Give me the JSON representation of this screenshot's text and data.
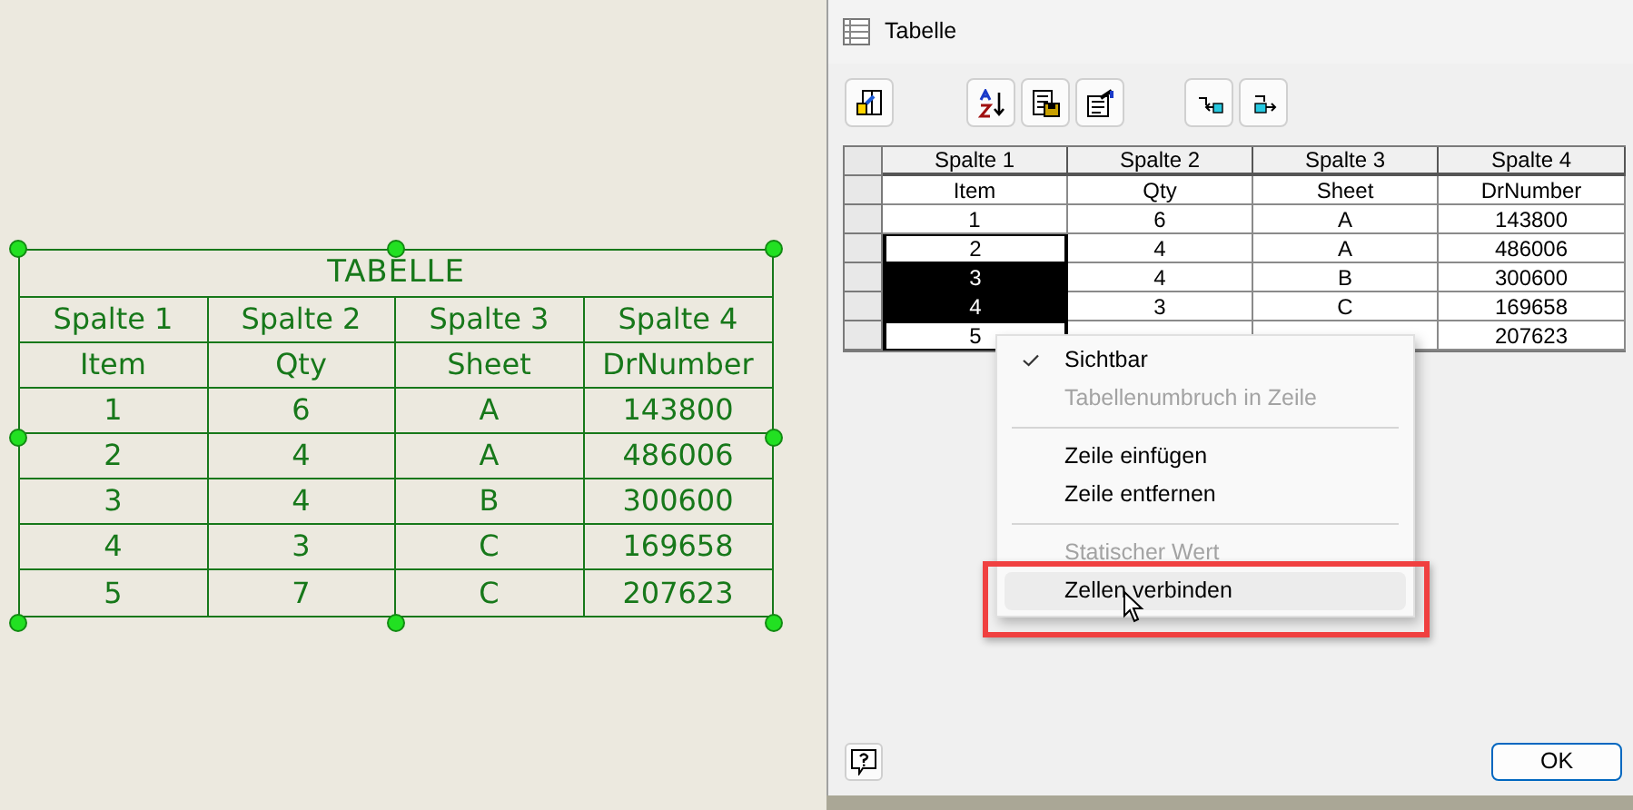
{
  "drawing": {
    "title": "TABELLE",
    "rows": [
      [
        "Spalte 1",
        "Spalte 2",
        "Spalte 3",
        "Spalte 4"
      ],
      [
        "Item",
        "Qty",
        "Sheet",
        "DrNumber"
      ],
      [
        "1",
        "6",
        "A",
        "143800"
      ],
      [
        "2",
        "4",
        "A",
        "486006"
      ],
      [
        "3",
        "4",
        "B",
        "300600"
      ],
      [
        "4",
        "3",
        "C",
        "169658"
      ],
      [
        "5",
        "7",
        "C",
        "207623"
      ]
    ]
  },
  "dialog": {
    "title": "Tabelle",
    "grid": {
      "columns": [
        "Spalte 1",
        "Spalte 2",
        "Spalte 3",
        "Spalte 4"
      ],
      "rows": [
        {
          "cells": [
            {
              "text": "Item",
              "selected": false,
              "in_range": false
            },
            {
              "text": "Qty",
              "selected": false,
              "in_range": false
            },
            {
              "text": "Sheet",
              "selected": false,
              "in_range": false
            },
            {
              "text": "DrNumber",
              "selected": false,
              "in_range": false
            }
          ]
        },
        {
          "cells": [
            {
              "text": "1",
              "selected": false,
              "in_range": false
            },
            {
              "text": "6",
              "selected": false,
              "in_range": false
            },
            {
              "text": "A",
              "selected": false,
              "in_range": false
            },
            {
              "text": "143800",
              "selected": false,
              "in_range": false
            }
          ]
        },
        {
          "cells": [
            {
              "text": "2",
              "selected": false,
              "in_range": true
            },
            {
              "text": "4",
              "selected": false,
              "in_range": false
            },
            {
              "text": "A",
              "selected": false,
              "in_range": false
            },
            {
              "text": "486006",
              "selected": false,
              "in_range": false
            }
          ]
        },
        {
          "cells": [
            {
              "text": "3",
              "selected": true,
              "in_range": true
            },
            {
              "text": "4",
              "selected": false,
              "in_range": false
            },
            {
              "text": "B",
              "selected": false,
              "in_range": false
            },
            {
              "text": "300600",
              "selected": false,
              "in_range": false
            }
          ]
        },
        {
          "cells": [
            {
              "text": "4",
              "selected": true,
              "in_range": true
            },
            {
              "text": "3",
              "selected": false,
              "in_range": false
            },
            {
              "text": "C",
              "selected": false,
              "in_range": false
            },
            {
              "text": "169658",
              "selected": false,
              "in_range": false
            }
          ]
        },
        {
          "cells": [
            {
              "text": "5",
              "selected": false,
              "in_range": true
            },
            {
              "selected": false,
              "in_range": false
            },
            {
              "selected": false,
              "in_range": false
            },
            {
              "text": "207623",
              "selected": false,
              "in_range": false
            }
          ]
        }
      ]
    },
    "context_menu": {
      "items": [
        {
          "kind": "item",
          "label": "Sichtbar",
          "checked": true,
          "disabled": false,
          "hovered": false
        },
        {
          "kind": "item",
          "label": "Tabellenumbruch in Zeile",
          "checked": false,
          "disabled": true,
          "hovered": false
        },
        {
          "kind": "separator"
        },
        {
          "kind": "item",
          "label": "Zeile einfügen",
          "checked": false,
          "disabled": false,
          "hovered": false
        },
        {
          "kind": "item",
          "label": "Zeile entfernen",
          "checked": false,
          "disabled": false,
          "hovered": false
        },
        {
          "kind": "separator"
        },
        {
          "kind": "item",
          "label": "Statischer Wert",
          "checked": false,
          "disabled": true,
          "hovered": false
        },
        {
          "kind": "item",
          "label": "Zellen verbinden",
          "checked": false,
          "disabled": false,
          "hovered": true
        }
      ]
    },
    "ok_button": "OK"
  }
}
